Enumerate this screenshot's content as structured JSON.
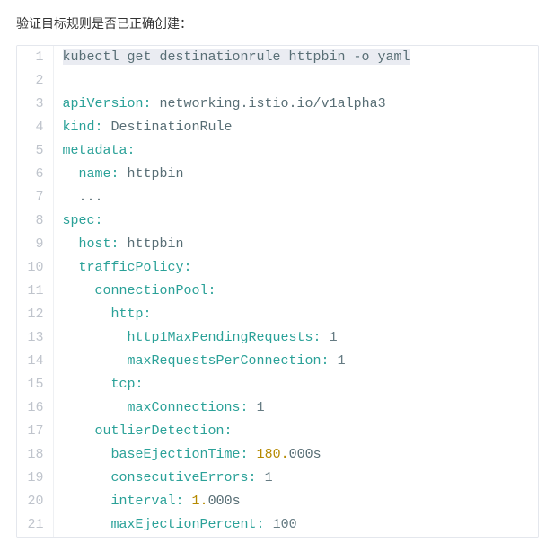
{
  "intro_text": "验证目标规则是否已正确创建：",
  "code_lines": [
    {
      "n": 1,
      "highlight": true,
      "segments": [
        {
          "cls": "tok-base",
          "t": "kubectl get destinationrule httpbin -o yaml"
        }
      ]
    },
    {
      "n": 2,
      "highlight": false,
      "segments": []
    },
    {
      "n": 3,
      "highlight": false,
      "segments": [
        {
          "cls": "tok-cyan",
          "t": "apiVersion:"
        },
        {
          "cls": "tok-base",
          "t": " networking.istio.io/v1alpha3"
        }
      ]
    },
    {
      "n": 4,
      "highlight": false,
      "segments": [
        {
          "cls": "tok-cyan",
          "t": "kind:"
        },
        {
          "cls": "tok-base",
          "t": " DestinationRule"
        }
      ]
    },
    {
      "n": 5,
      "highlight": false,
      "segments": [
        {
          "cls": "tok-cyan",
          "t": "metadata:"
        }
      ]
    },
    {
      "n": 6,
      "highlight": false,
      "segments": [
        {
          "cls": "tok-base",
          "t": "  "
        },
        {
          "cls": "tok-cyan",
          "t": "name:"
        },
        {
          "cls": "tok-base",
          "t": " httpbin"
        }
      ]
    },
    {
      "n": 7,
      "highlight": false,
      "segments": [
        {
          "cls": "tok-base",
          "t": "  ..."
        }
      ]
    },
    {
      "n": 8,
      "highlight": false,
      "segments": [
        {
          "cls": "tok-cyan",
          "t": "spec:"
        }
      ]
    },
    {
      "n": 9,
      "highlight": false,
      "segments": [
        {
          "cls": "tok-base",
          "t": "  "
        },
        {
          "cls": "tok-cyan",
          "t": "host:"
        },
        {
          "cls": "tok-base",
          "t": " httpbin"
        }
      ]
    },
    {
      "n": 10,
      "highlight": false,
      "segments": [
        {
          "cls": "tok-base",
          "t": "  "
        },
        {
          "cls": "tok-cyan",
          "t": "trafficPolicy:"
        }
      ]
    },
    {
      "n": 11,
      "highlight": false,
      "segments": [
        {
          "cls": "tok-base",
          "t": "    "
        },
        {
          "cls": "tok-cyan",
          "t": "connectionPool:"
        }
      ]
    },
    {
      "n": 12,
      "highlight": false,
      "segments": [
        {
          "cls": "tok-base",
          "t": "      "
        },
        {
          "cls": "tok-cyan",
          "t": "http:"
        }
      ]
    },
    {
      "n": 13,
      "highlight": false,
      "segments": [
        {
          "cls": "tok-base",
          "t": "        "
        },
        {
          "cls": "tok-cyan",
          "t": "http1MaxPendingRequests:"
        },
        {
          "cls": "tok-base",
          "t": " "
        },
        {
          "cls": "tok-digit",
          "t": "1"
        }
      ]
    },
    {
      "n": 14,
      "highlight": false,
      "segments": [
        {
          "cls": "tok-base",
          "t": "        "
        },
        {
          "cls": "tok-cyan",
          "t": "maxRequestsPerConnection:"
        },
        {
          "cls": "tok-base",
          "t": " "
        },
        {
          "cls": "tok-digit",
          "t": "1"
        }
      ]
    },
    {
      "n": 15,
      "highlight": false,
      "segments": [
        {
          "cls": "tok-base",
          "t": "      "
        },
        {
          "cls": "tok-cyan",
          "t": "tcp:"
        }
      ]
    },
    {
      "n": 16,
      "highlight": false,
      "segments": [
        {
          "cls": "tok-base",
          "t": "        "
        },
        {
          "cls": "tok-cyan",
          "t": "maxConnections:"
        },
        {
          "cls": "tok-base",
          "t": " "
        },
        {
          "cls": "tok-digit",
          "t": "1"
        }
      ]
    },
    {
      "n": 17,
      "highlight": false,
      "segments": [
        {
          "cls": "tok-base",
          "t": "    "
        },
        {
          "cls": "tok-cyan",
          "t": "outlierDetection:"
        }
      ]
    },
    {
      "n": 18,
      "highlight": false,
      "segments": [
        {
          "cls": "tok-base",
          "t": "      "
        },
        {
          "cls": "tok-cyan",
          "t": "baseEjectionTime:"
        },
        {
          "cls": "tok-base",
          "t": " "
        },
        {
          "cls": "tok-orange",
          "t": "180."
        },
        {
          "cls": "tok-base",
          "t": "000s"
        }
      ]
    },
    {
      "n": 19,
      "highlight": false,
      "segments": [
        {
          "cls": "tok-base",
          "t": "      "
        },
        {
          "cls": "tok-cyan",
          "t": "consecutiveErrors:"
        },
        {
          "cls": "tok-base",
          "t": " "
        },
        {
          "cls": "tok-digit",
          "t": "1"
        }
      ]
    },
    {
      "n": 20,
      "highlight": false,
      "segments": [
        {
          "cls": "tok-base",
          "t": "      "
        },
        {
          "cls": "tok-cyan",
          "t": "interval:"
        },
        {
          "cls": "tok-base",
          "t": " "
        },
        {
          "cls": "tok-orange",
          "t": "1."
        },
        {
          "cls": "tok-base",
          "t": "000s"
        }
      ]
    },
    {
      "n": 21,
      "highlight": false,
      "segments": [
        {
          "cls": "tok-base",
          "t": "      "
        },
        {
          "cls": "tok-cyan",
          "t": "maxEjectionPercent:"
        },
        {
          "cls": "tok-base",
          "t": " "
        },
        {
          "cls": "tok-digit",
          "t": "100"
        }
      ]
    }
  ]
}
